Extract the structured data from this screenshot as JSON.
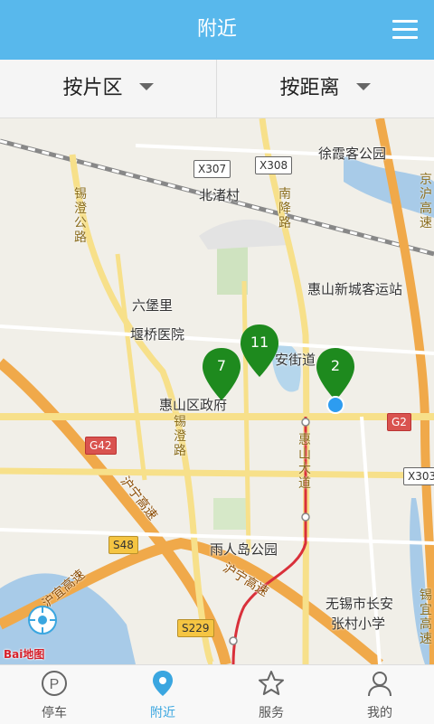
{
  "header": {
    "title": "附近",
    "menu_icon": "hamburger-menu-icon"
  },
  "filters": [
    {
      "label": "按片区"
    },
    {
      "label": "按距离"
    }
  ],
  "map": {
    "labels": {
      "xuxiake_park": "徐霞客公园",
      "beizhu_village": "北渚村",
      "huishan_bus_station": "惠山新城客运站",
      "liubaoli": "六堡里",
      "yanqiao_hospital": "堰桥医院",
      "huishan_gov": "惠山区政府",
      "anjie_road": "安街道",
      "yurendao_park": "雨人岛公园",
      "changan_school_1": "无锡市长安",
      "changan_school_2": "张村小学"
    },
    "roads": {
      "xicheng": "锡澄公路",
      "nanjiang": "南降路",
      "xicheng2": "锡澄路",
      "huishan_ave": "惠山大道",
      "huning": "沪宁高速",
      "huyi": "沪宜高速",
      "jinghu": "京沪高速",
      "huning_right": "锡宜高速"
    },
    "shields": {
      "x307": "X307",
      "x308": "X308",
      "g2": "G2",
      "g42": "G42",
      "x303": "X303",
      "s48": "S48",
      "s229": "S229"
    },
    "pins": [
      {
        "count": "7"
      },
      {
        "count": "11"
      },
      {
        "count": "2"
      }
    ],
    "logo": "Bai地图"
  },
  "tabs": [
    {
      "label": "停车",
      "icon": "parking-icon",
      "active": false
    },
    {
      "label": "附近",
      "icon": "location-pin-icon",
      "active": true
    },
    {
      "label": "服务",
      "icon": "star-icon",
      "active": false
    },
    {
      "label": "我的",
      "icon": "user-icon",
      "active": false
    }
  ],
  "colors": {
    "header": "#58b8ec",
    "accent": "#3aa6e0",
    "pin": "#1e8a1e",
    "location_dot": "#2d9cf0"
  }
}
